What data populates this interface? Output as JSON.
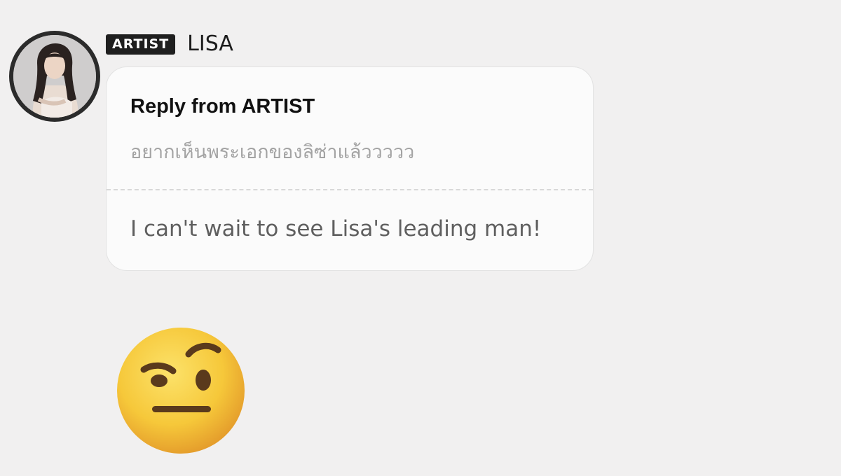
{
  "user": {
    "badge": "ARTIST",
    "name": "LISA",
    "avatar_icon": "profile-photo"
  },
  "reply": {
    "header": "Reply from ARTIST",
    "original": "อยากเห็นพระเอกของลิซ่าแล้ววววว",
    "translation": "I can't wait to see Lisa's leading man!"
  },
  "sticker": {
    "icon": "face-with-raised-eyebrow-emoji"
  },
  "colors": {
    "background": "#f1f0f0",
    "badge_bg": "#1f1f1f",
    "bubble_bg": "#fbfbfb",
    "emoji_yellow": "#f6c83a"
  }
}
